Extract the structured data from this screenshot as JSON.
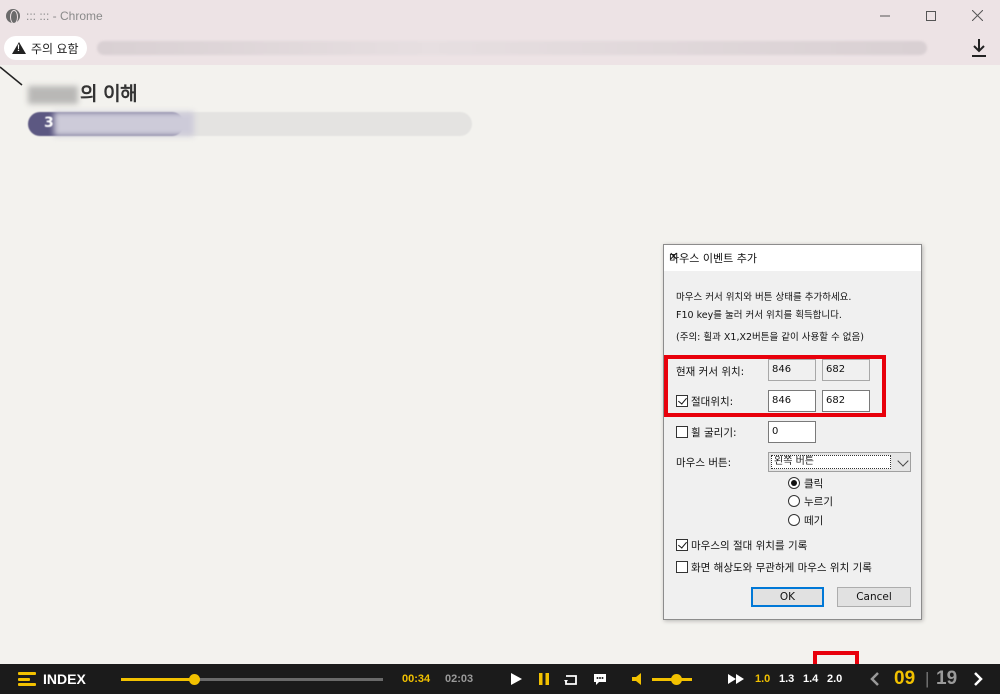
{
  "browser": {
    "title": "::: ::: - Chrome",
    "security_chip": "주의 요함"
  },
  "page": {
    "heading_visible": "의 이해",
    "pill_number": "3"
  },
  "dialog": {
    "title": "마우스 이벤트 추가",
    "close": "✕",
    "desc_line1": "마우스 커서 위치와 버튼 상태를 추가하세요.",
    "desc_line2": "F10 key를 눌러 커서 위치를 획득합니다.",
    "desc_line3": "(주의: 휠과 X1,X2버튼을 같이 사용할 수 없음)",
    "current_pos_label": "현재 커서 위치:",
    "current_x": "846",
    "current_y": "682",
    "absolute_label": "절대위치:",
    "absolute_checked": true,
    "absolute_x": "846",
    "absolute_y": "682",
    "wheel_label": "휠 굴리기:",
    "wheel_checked": false,
    "wheel_value": "0",
    "button_label": "마우스 버튼:",
    "button_selected": "왼쪽 버튼",
    "radio_click": "클릭",
    "radio_press": "누르기",
    "radio_release": "떼기",
    "radio_selected": "클릭",
    "record_abs_label": "마우스의 절대 위치를 기록",
    "record_abs_checked": true,
    "record_res_label": "화면 해상도와 무관하게 마우스 위치 기록",
    "record_res_checked": false,
    "ok": "OK",
    "cancel": "Cancel"
  },
  "player": {
    "index_label": "INDEX",
    "time_current": "00:34",
    "time_total": "02:03",
    "progress": 0.28,
    "volume": 0.6,
    "speeds": [
      "1.0",
      "1.3",
      "1.4",
      "2.0"
    ],
    "speed_selected": "2.0",
    "page_current": "09",
    "page_separator": "|",
    "page_total": "19"
  },
  "colors": {
    "accent": "#f2c100",
    "highlight_box": "#e8000b",
    "dialog_bg": "#f0f0f0",
    "player_bg": "#1b1b1b"
  }
}
